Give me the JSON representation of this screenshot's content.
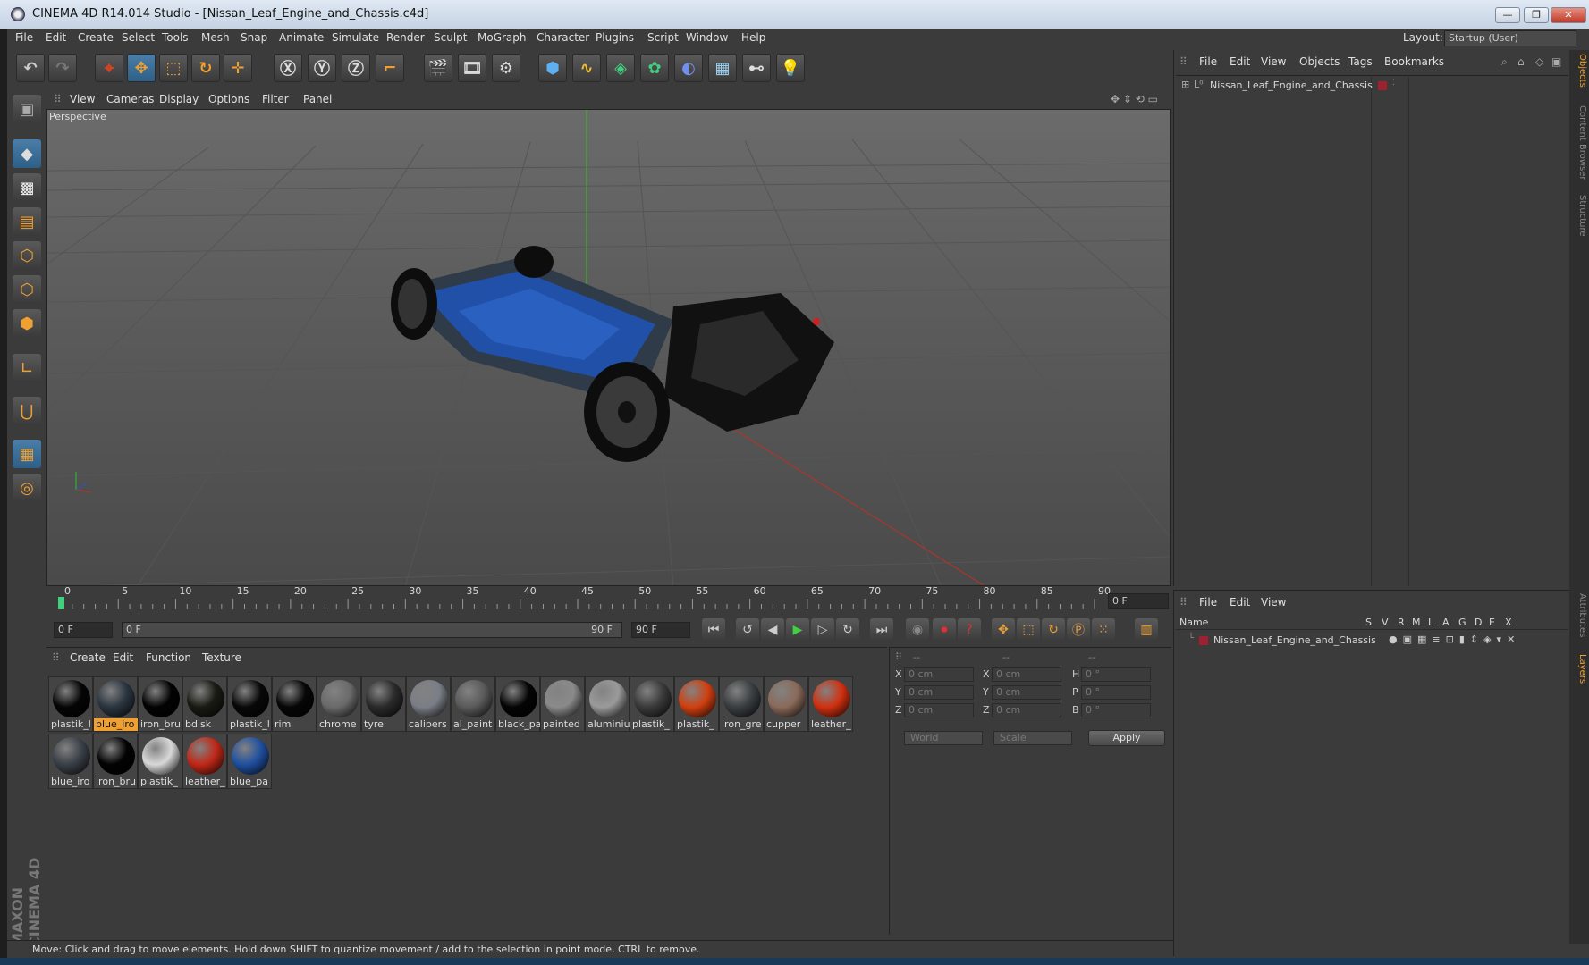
{
  "window": {
    "title": "CINEMA 4D R14.014 Studio - [Nissan_Leaf_Engine_and_Chassis.c4d]",
    "minimize": "—",
    "maximize": "❐",
    "close": "✕"
  },
  "menubar": [
    "File",
    "Edit",
    "Create",
    "Select",
    "Tools",
    "Mesh",
    "Snap",
    "Animate",
    "Simulate",
    "Render",
    "Sculpt",
    "MoGraph",
    "Character",
    "Plugins",
    "Script",
    "Window",
    "Help"
  ],
  "layout": {
    "label": "Layout:",
    "value": "Startup (User)"
  },
  "viewport": {
    "menu": [
      "View",
      "Cameras",
      "Display",
      "Options",
      "Filter",
      "Panel"
    ],
    "label": "Perspective"
  },
  "timeline": {
    "ticks": [
      "0",
      "5",
      "10",
      "15",
      "20",
      "25",
      "30",
      "35",
      "40",
      "45",
      "50",
      "55",
      "60",
      "65",
      "70",
      "75",
      "80",
      "85",
      "90"
    ],
    "current_frame": "0 F",
    "start": "0 F",
    "range_start": "0 F",
    "range_end": "90 F",
    "end": "90 F"
  },
  "materials": {
    "menu": [
      "Create",
      "Edit",
      "Function",
      "Texture"
    ],
    "items": [
      {
        "name": "plastik_l",
        "color": "#050505",
        "selected": false
      },
      {
        "name": "blue_iro",
        "color": "#2a3540",
        "selected": true
      },
      {
        "name": "iron_bru",
        "color": "#020202",
        "selected": false
      },
      {
        "name": "bdisk",
        "color": "#1a1a14",
        "selected": false
      },
      {
        "name": "plastik_l",
        "color": "#080808",
        "selected": false
      },
      {
        "name": "rim",
        "color": "#060606",
        "selected": false
      },
      {
        "name": "chrome",
        "color": "#6a6a6a",
        "selected": false
      },
      {
        "name": "tyre",
        "color": "#2a2a2a",
        "selected": false
      },
      {
        "name": "calipers",
        "color": "#7a7e86",
        "selected": false
      },
      {
        "name": "al_paint",
        "color": "#5a5a5a",
        "selected": false
      },
      {
        "name": "black_pa",
        "color": "#040404",
        "selected": false
      },
      {
        "name": "painted",
        "color": "#8a8a8a",
        "selected": false
      },
      {
        "name": "aluminiu",
        "color": "#9a9a9a",
        "selected": false
      },
      {
        "name": "plastik_",
        "color": "#3a3a3a",
        "selected": false
      },
      {
        "name": "plastik_",
        "color": "#d04010",
        "selected": false
      },
      {
        "name": "iron_gre",
        "color": "#3a3e40",
        "selected": false
      },
      {
        "name": "cupper",
        "color": "#8a6a5a",
        "selected": false
      },
      {
        "name": "leather_",
        "color": "#d03010",
        "selected": false
      },
      {
        "name": "blue_iro",
        "color": "#3a4048",
        "selected": false
      },
      {
        "name": "iron_bru",
        "color": "#030303",
        "selected": false
      },
      {
        "name": "plastik_",
        "color": "#d8d8d8",
        "selected": false
      },
      {
        "name": "leather_",
        "color": "#c02818",
        "selected": false
      },
      {
        "name": "blue_pa",
        "color": "#2050a0",
        "selected": false
      }
    ]
  },
  "coordinates": {
    "headers": [
      "--",
      "--",
      "--"
    ],
    "rows": [
      {
        "a": "X",
        "av": "0 cm",
        "b": "X",
        "bv": "0 cm",
        "c": "H",
        "cv": "0 °"
      },
      {
        "a": "Y",
        "av": "0 cm",
        "b": "Y",
        "bv": "0 cm",
        "c": "P",
        "cv": "0 °"
      },
      {
        "a": "Z",
        "av": "0 cm",
        "b": "Z",
        "bv": "0 cm",
        "c": "B",
        "cv": "0 °"
      }
    ],
    "world": "World",
    "scale": "Scale",
    "apply": "Apply"
  },
  "objects": {
    "menu": [
      "File",
      "Edit",
      "View",
      "Objects",
      "Tags",
      "Bookmarks"
    ],
    "item": "Nissan_Leaf_Engine_and_Chassis"
  },
  "layers": {
    "menu": [
      "File",
      "Edit",
      "View"
    ],
    "columns": [
      "Name",
      "S",
      "V",
      "R",
      "M",
      "L",
      "A",
      "G",
      "D",
      "E",
      "X"
    ],
    "item": "Nissan_Leaf_Engine_and_Chassis"
  },
  "sidetabs": [
    "Objects",
    "Content Browser",
    "Structure",
    "Attributes",
    "Layers"
  ],
  "status": "Move: Click and drag to move elements. Hold down SHIFT to quantize movement / add to the selection in point mode, CTRL to remove.",
  "brand": "MAXON CINEMA 4D"
}
